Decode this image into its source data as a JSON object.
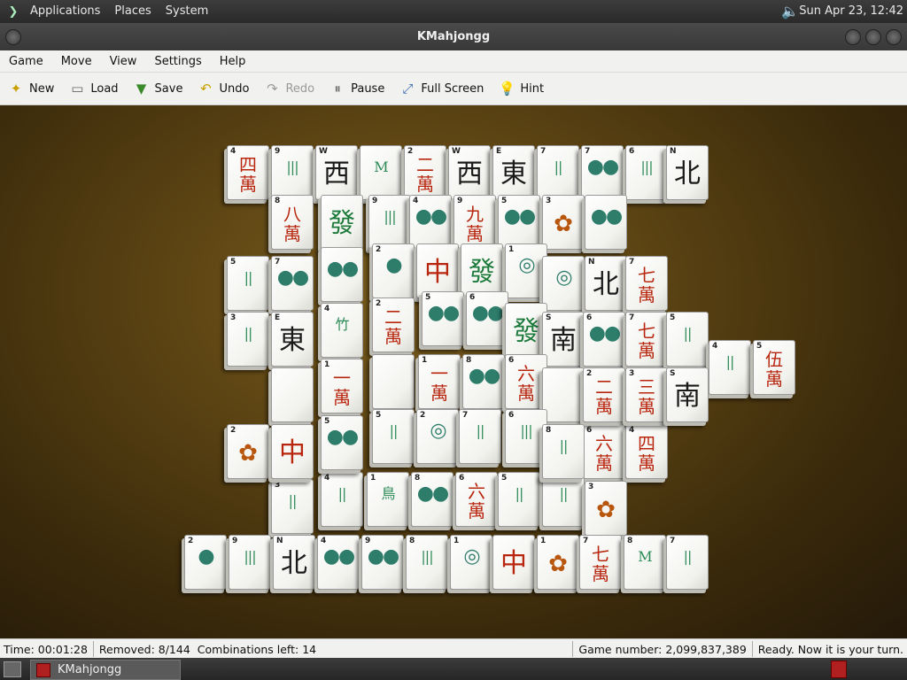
{
  "top_panel": {
    "menus": [
      "Applications",
      "Places",
      "System"
    ],
    "clock": "Sun Apr 23, 12:42"
  },
  "window": {
    "title": "KMahjongg"
  },
  "menubar": [
    "Game",
    "Move",
    "View",
    "Settings",
    "Help"
  ],
  "toolbar": {
    "new": "New",
    "load": "Load",
    "save": "Save",
    "undo": "Undo",
    "redo": "Redo",
    "pause": "Pause",
    "fullscreen": "Full Screen",
    "hint": "Hint"
  },
  "status": {
    "time": "Time: 00:01:28",
    "removed": "Removed: 8/144",
    "combinations": "Combinations left: 14",
    "game_number": "Game number: 2,099,837,389",
    "message": "Ready. Now it is your turn."
  },
  "taskbar": {
    "task": "KMahjongg"
  },
  "tiles": [
    {
      "n": "4",
      "f": "四\n萬",
      "c": "red"
    },
    {
      "n": "9",
      "f": "|||",
      "c": "bam"
    },
    {
      "n": "W",
      "f": "西",
      "c": "black"
    },
    {
      "n": "",
      "f": "M",
      "c": "bam"
    },
    {
      "n": "2",
      "f": "二\n萬",
      "c": "red"
    },
    {
      "n": "W",
      "f": "西",
      "c": "black"
    },
    {
      "n": "E",
      "f": "東",
      "c": "black"
    },
    {
      "n": "7",
      "f": "||",
      "c": "bam"
    },
    {
      "n": "7",
      "f": "●●",
      "c": "dots"
    },
    {
      "n": "6",
      "f": "|||",
      "c": "bam"
    },
    {
      "n": "N",
      "f": "北",
      "c": "black"
    },
    {
      "n": "8",
      "f": "八\n萬",
      "c": "red"
    },
    {
      "n": "",
      "f": "發",
      "c": "green"
    },
    {
      "n": "9",
      "f": "|||",
      "c": "bam"
    },
    {
      "n": "4",
      "f": "●●",
      "c": "dots"
    },
    {
      "n": "9",
      "f": "九\n萬",
      "c": "red"
    },
    {
      "n": "5",
      "f": "●●",
      "c": "dots"
    },
    {
      "n": "3",
      "f": "✿",
      "c": "flower"
    },
    {
      "n": "",
      "f": "●●",
      "c": "dots"
    },
    {
      "n": "5",
      "f": "||",
      "c": "bam"
    },
    {
      "n": "7",
      "f": "●●",
      "c": "dots"
    },
    {
      "n": "",
      "f": "●●",
      "c": "dots"
    },
    {
      "n": "2",
      "f": "●",
      "c": "dots"
    },
    {
      "n": "",
      "f": "中",
      "c": "red"
    },
    {
      "n": "",
      "f": "發",
      "c": "green"
    },
    {
      "n": "1",
      "f": "◎",
      "c": "dots"
    },
    {
      "n": "",
      "f": "◎",
      "c": "dots"
    },
    {
      "n": "N",
      "f": "北",
      "c": "black"
    },
    {
      "n": "7",
      "f": "七\n萬",
      "c": "red"
    },
    {
      "n": "3",
      "f": "||",
      "c": "bam"
    },
    {
      "n": "E",
      "f": "東",
      "c": "black"
    },
    {
      "n": "4",
      "f": "竹",
      "c": "bam"
    },
    {
      "n": "2",
      "f": "二\n萬",
      "c": "red"
    },
    {
      "n": "5",
      "f": "●●",
      "c": "dots"
    },
    {
      "n": "6",
      "f": "●●",
      "c": "dots"
    },
    {
      "n": "",
      "f": "發",
      "c": "green"
    },
    {
      "n": "S",
      "f": "南",
      "c": "black"
    },
    {
      "n": "6",
      "f": "●●",
      "c": "dots"
    },
    {
      "n": "7",
      "f": "七\n萬",
      "c": "red"
    },
    {
      "n": "5",
      "f": "||",
      "c": "bam"
    },
    {
      "n": "4",
      "f": "||",
      "c": "bam"
    },
    {
      "n": "5",
      "f": "伍\n萬",
      "c": "red"
    },
    {
      "n": "",
      "f": "",
      "c": "black"
    },
    {
      "n": "1",
      "f": "一\n萬",
      "c": "red"
    },
    {
      "n": "",
      "f": "",
      "c": "black"
    },
    {
      "n": "1",
      "f": "一\n萬",
      "c": "red"
    },
    {
      "n": "8",
      "f": "●●",
      "c": "dots"
    },
    {
      "n": "6",
      "f": "六\n萬",
      "c": "red"
    },
    {
      "n": "",
      "f": "",
      "c": "black"
    },
    {
      "n": "2",
      "f": "二\n萬",
      "c": "red"
    },
    {
      "n": "3",
      "f": "三\n萬",
      "c": "red"
    },
    {
      "n": "S",
      "f": "南",
      "c": "black"
    },
    {
      "n": "2",
      "f": "✿",
      "c": "flower"
    },
    {
      "n": "",
      "f": "中",
      "c": "red"
    },
    {
      "n": "5",
      "f": "●●",
      "c": "dots"
    },
    {
      "n": "5",
      "f": "||",
      "c": "bam"
    },
    {
      "n": "2",
      "f": "◎",
      "c": "dots"
    },
    {
      "n": "7",
      "f": "||",
      "c": "bam"
    },
    {
      "n": "6",
      "f": "|||",
      "c": "bam"
    },
    {
      "n": "8",
      "f": "||",
      "c": "bam"
    },
    {
      "n": "6",
      "f": "六\n萬",
      "c": "red"
    },
    {
      "n": "4",
      "f": "四\n萬",
      "c": "red"
    },
    {
      "n": "3",
      "f": "||",
      "c": "bam"
    },
    {
      "n": "4",
      "f": "||",
      "c": "bam"
    },
    {
      "n": "1",
      "f": "鳥",
      "c": "bam"
    },
    {
      "n": "8",
      "f": "●●",
      "c": "dots"
    },
    {
      "n": "6",
      "f": "六\n萬",
      "c": "red"
    },
    {
      "n": "5",
      "f": "||",
      "c": "bam"
    },
    {
      "n": "2",
      "f": "||",
      "c": "bam"
    },
    {
      "n": "3",
      "f": "✿",
      "c": "flower"
    },
    {
      "n": "2",
      "f": "●",
      "c": "dots"
    },
    {
      "n": "9",
      "f": "|||",
      "c": "bam"
    },
    {
      "n": "N",
      "f": "北",
      "c": "black"
    },
    {
      "n": "4",
      "f": "●●",
      "c": "dots"
    },
    {
      "n": "9",
      "f": "●●",
      "c": "dots"
    },
    {
      "n": "8",
      "f": "|||",
      "c": "bam"
    },
    {
      "n": "1",
      "f": "◎",
      "c": "dots"
    },
    {
      "n": "",
      "f": "中",
      "c": "red"
    },
    {
      "n": "1",
      "f": "✿",
      "c": "flower"
    },
    {
      "n": "7",
      "f": "七\n萬",
      "c": "red"
    },
    {
      "n": "8",
      "f": "M",
      "c": "bam"
    },
    {
      "n": "7",
      "f": "||",
      "c": "bam"
    }
  ]
}
